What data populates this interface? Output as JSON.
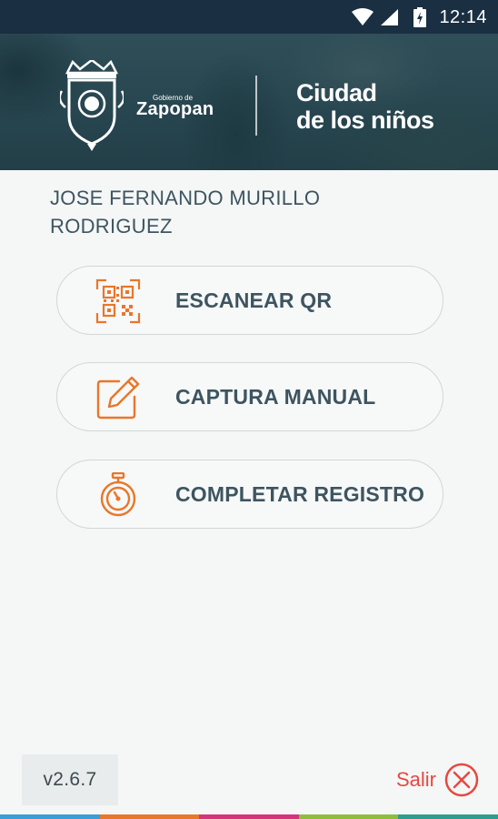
{
  "status_bar": {
    "time": "12:14",
    "icons": [
      "wifi-icon",
      "cell-signal-icon",
      "battery-charging-icon"
    ]
  },
  "header": {
    "logo_line1": "Gobierno de",
    "logo_line2": "Zapopan",
    "campaign_line1": "Ciudad",
    "campaign_line2": "de los niños"
  },
  "user": {
    "full_name": "JOSE FERNANDO MURILLO RODRIGUEZ"
  },
  "actions": [
    {
      "label": "ESCANEAR QR",
      "icon": "qr-code-icon"
    },
    {
      "label": "CAPTURA MANUAL",
      "icon": "edit-icon"
    },
    {
      "label": "COMPLETAR REGISTRO",
      "icon": "stopwatch-icon"
    }
  ],
  "footer": {
    "version": "v2.6.7",
    "logout_label": "Salir",
    "logout_icon": "close-circle-icon"
  },
  "colors": {
    "accent": "#e8772a",
    "text": "#3d5560",
    "danger": "#e34a42",
    "status_bar": "#1b2f42",
    "strip": [
      "#3a9ed8",
      "#e8772a",
      "#d6337d",
      "#8ebd3c",
      "#2e9c8e"
    ]
  }
}
